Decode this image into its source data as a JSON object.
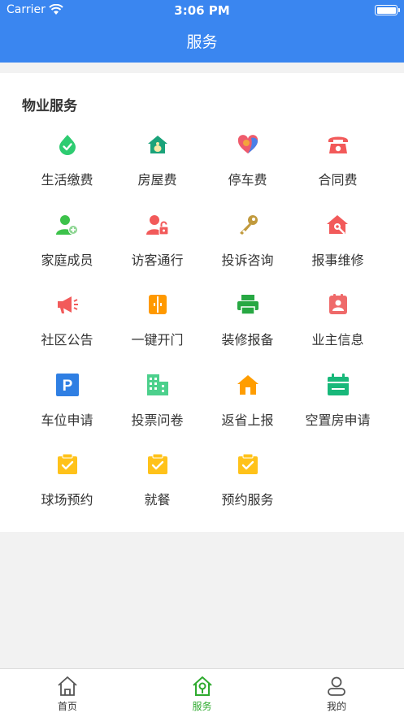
{
  "status_bar": {
    "carrier": "Carrier",
    "time": "3:06 PM"
  },
  "header": {
    "title": "服务"
  },
  "section": {
    "title": "物业服务"
  },
  "services": [
    {
      "label": "生活缴费",
      "icon": "drop-check-icon"
    },
    {
      "label": "房屋费",
      "icon": "house-money-icon"
    },
    {
      "label": "停车费",
      "icon": "heart-icon"
    },
    {
      "label": "合同费",
      "icon": "telephone-icon"
    },
    {
      "label": "家庭成员",
      "icon": "user-add-icon"
    },
    {
      "label": "访客通行",
      "icon": "user-lock-icon"
    },
    {
      "label": "投诉咨询",
      "icon": "key-icon"
    },
    {
      "label": "报事维修",
      "icon": "house-wrench-icon"
    },
    {
      "label": "社区公告",
      "icon": "megaphone-icon"
    },
    {
      "label": "一键开门",
      "icon": "door-icon"
    },
    {
      "label": "装修报备",
      "icon": "printer-icon"
    },
    {
      "label": "业主信息",
      "icon": "id-card-icon"
    },
    {
      "label": "车位申请",
      "icon": "parking-icon"
    },
    {
      "label": "投票问卷",
      "icon": "building-icon"
    },
    {
      "label": "返省上报",
      "icon": "house-icon"
    },
    {
      "label": "空置房申请",
      "icon": "calendar-icon"
    },
    {
      "label": "球场预约",
      "icon": "clipboard-check-icon"
    },
    {
      "label": "就餐",
      "icon": "clipboard-check-icon"
    },
    {
      "label": "预约服务",
      "icon": "clipboard-check-icon"
    }
  ],
  "tabs": [
    {
      "label": "首页",
      "icon": "home-icon"
    },
    {
      "label": "服务",
      "icon": "service-home-icon",
      "active": true
    },
    {
      "label": "我的",
      "icon": "user-icon"
    }
  ],
  "colors": {
    "header": "#3a86f0",
    "active_tab": "#2eaa2e",
    "accent_green": "#2ecc71",
    "accent_red": "#f25a5a",
    "accent_orange": "#ffa500"
  }
}
